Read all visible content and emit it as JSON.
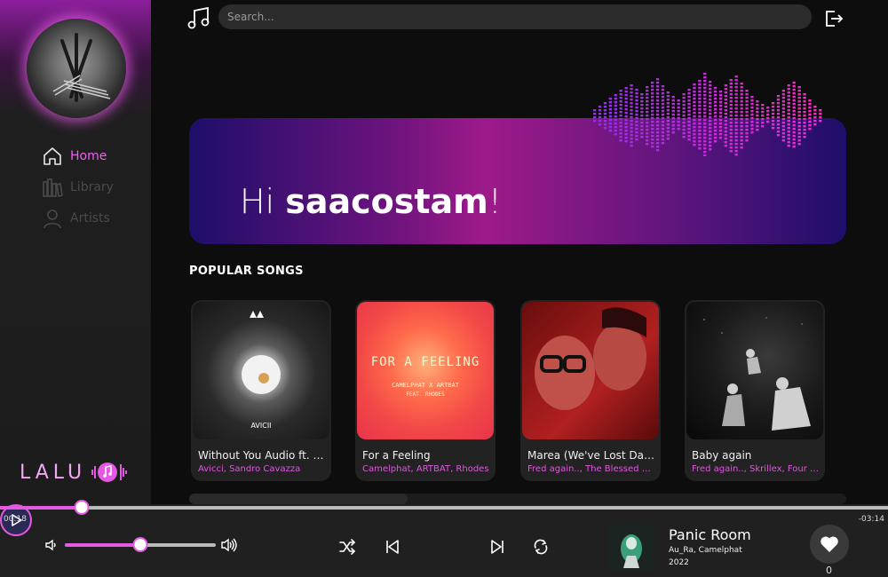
{
  "app": {
    "logo_text": "LALU"
  },
  "sidebar": {
    "items": [
      {
        "label": "Home",
        "icon": "home-icon",
        "active": true
      },
      {
        "label": "Library",
        "icon": "library-icon",
        "active": false
      },
      {
        "label": "Artists",
        "icon": "user-icon",
        "active": false
      }
    ]
  },
  "header": {
    "search_placeholder": "Search..."
  },
  "hero": {
    "greeting_prefix": "Hi ",
    "username": "saacostam",
    "greeting_suffix": "!"
  },
  "popular": {
    "title": "POPULAR SONGS",
    "songs": [
      {
        "title": "Without You Audio ft. Sandro Cavazza",
        "artist": "Avicci, Sandro Cavazza",
        "art_caption": "AVICII"
      },
      {
        "title": "For a Feeling",
        "artist": "Camelphat, ARTBAT, Rhodes",
        "art_caption": "FOR A FEELING",
        "art_subcaption": "CAMELPHAT X ARTBAT",
        "art_subcaption2": "FEAT. RHODES"
      },
      {
        "title": "Marea (We've Lost Dancing)",
        "artist": "Fred again.., The Blessed Madonna"
      },
      {
        "title": "Baby again",
        "artist": "Fred again.., Skrillex, Four Tet"
      }
    ]
  },
  "player": {
    "elapsed": "00:18",
    "remaining": "-03:14",
    "progress_fraction": 0.092,
    "volume_fraction": 0.5,
    "now_playing": {
      "title": "Panic Room",
      "artist": "Au_Ra, Camelphat",
      "year": "2022"
    },
    "likes": "0"
  },
  "colors": {
    "accent": "#e459e1",
    "background": "#0d0d0d",
    "sidebar": "#1c1c1c"
  }
}
